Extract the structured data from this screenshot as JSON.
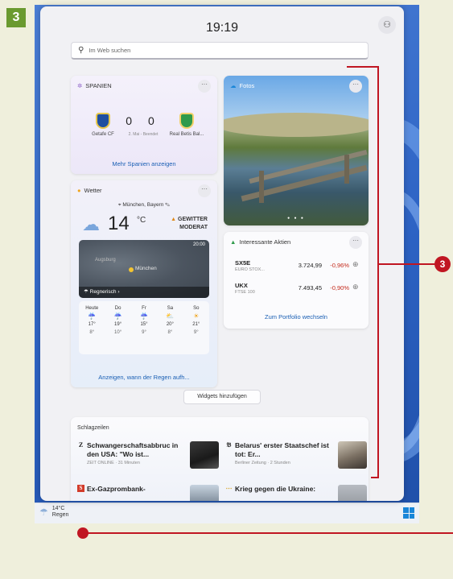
{
  "figure_badge": "3",
  "callout_number": "3",
  "panel": {
    "clock": "19:19",
    "profile_icon": "person-icon",
    "search_placeholder": "Im Web suchen",
    "add_widgets_label": "Widgets hinzufügen"
  },
  "sports": {
    "title": "SPANIEN",
    "home_team": "Getafe CF",
    "away_team": "Real Betis Bal...",
    "score": "0 0",
    "status": "2. Mai - Beendet",
    "more_link": "Mehr Spanien anzeigen"
  },
  "photos": {
    "title": "Fotos"
  },
  "weather": {
    "title": "Wetter",
    "location": "München, Bayern",
    "temperature": "14",
    "unit": "°C",
    "alert_line1": "GEWITTER",
    "alert_line2": "MODERAT",
    "map_time": "20:00",
    "map_city": "München",
    "map_city2": "Augsburg",
    "condition": "Regnerisch",
    "forecast": [
      {
        "day": "Heute",
        "high": "17°",
        "low": "8°",
        "icon": "rain-icon"
      },
      {
        "day": "Do",
        "high": "19°",
        "low": "10°",
        "icon": "rain-icon"
      },
      {
        "day": "Fr",
        "high": "15°",
        "low": "9°",
        "icon": "rain-icon"
      },
      {
        "day": "Sa",
        "high": "20°",
        "low": "8°",
        "icon": "partly-sunny-icon"
      },
      {
        "day": "So",
        "high": "21°",
        "low": "9°",
        "icon": "sun-icon"
      }
    ],
    "more_link": "Anzeigen, wann der Regen aufh..."
  },
  "stocks": {
    "title": "Interessante Aktien",
    "items": [
      {
        "symbol": "SX5E",
        "name": "EURO STOX...",
        "value": "3.724,99",
        "change": "-0,96%"
      },
      {
        "symbol": "UKX",
        "name": "FTSE 100",
        "value": "7.493,45",
        "change": "-0,90%"
      }
    ],
    "more_link": "Zum Portfolio wechseln"
  },
  "news": {
    "title": "Schlagzeilen",
    "articles": [
      {
        "source_glyph": "Z",
        "headline": "Schwangerschaftsabbruc in den USA: \"Wo ist...",
        "meta": "ZEIT ONLINE · 31 Minuten"
      },
      {
        "source_glyph": "𝔅",
        "headline": "Belarus' erster Staatschef ist tot: Er...",
        "meta": "Berliner Zeitung · 2 Stunden"
      },
      {
        "source_glyph": "S",
        "headline": "Ex-Gazprombank-",
        "meta": ""
      },
      {
        "source_glyph": "⋯",
        "headline": "Krieg gegen die Ukraine:",
        "meta": ""
      }
    ]
  },
  "taskbar": {
    "weather_temp": "14°C",
    "weather_text": "Regen"
  },
  "colors": {
    "accent_red": "#c01622",
    "link_blue": "#1a5fb4",
    "badge_green": "#6a9a2f"
  }
}
